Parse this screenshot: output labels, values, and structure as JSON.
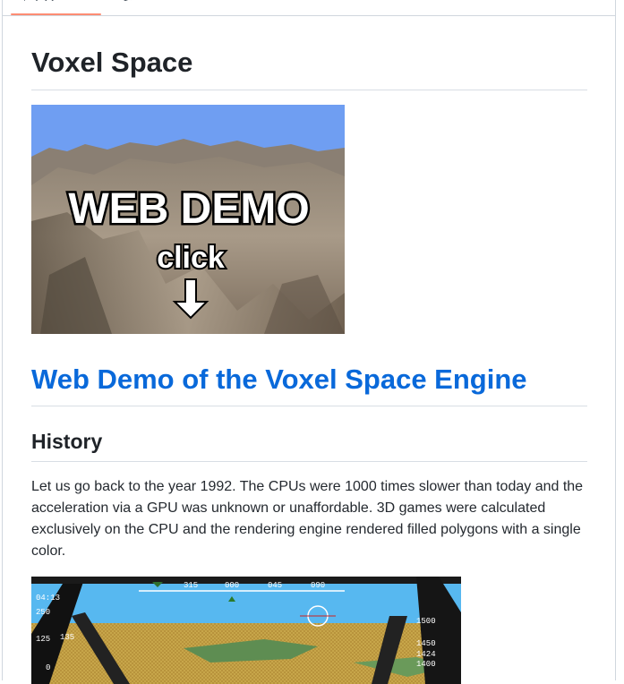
{
  "page": {
    "title": "Voxel Space",
    "demo_link_text": "Web Demo of the Voxel Space Engine",
    "history_heading": "History",
    "history_paragraph": "Let us go back to the year 1992. The CPUs were 1000 times slower than today and the acceleration via a GPU was unknown or unaffordable. 3D games were calculated exclusively on the CPU and the rendering engine rendered filled polygons with a single color."
  },
  "demo_image": {
    "headline": "WEB DEMO",
    "subline": "click",
    "sky_color": "#6f9ef2"
  },
  "cockpit_image": {
    "compass_ticks": [
      "315",
      "000",
      "045",
      "090"
    ],
    "time": "04:13",
    "left_scale": [
      "250",
      "125",
      "0"
    ],
    "speed": "135",
    "right_scale": [
      "1500",
      "1450",
      "1424",
      "1400"
    ]
  },
  "colors": {
    "accent_tab": "#fd8c73",
    "link": "#0969da"
  }
}
